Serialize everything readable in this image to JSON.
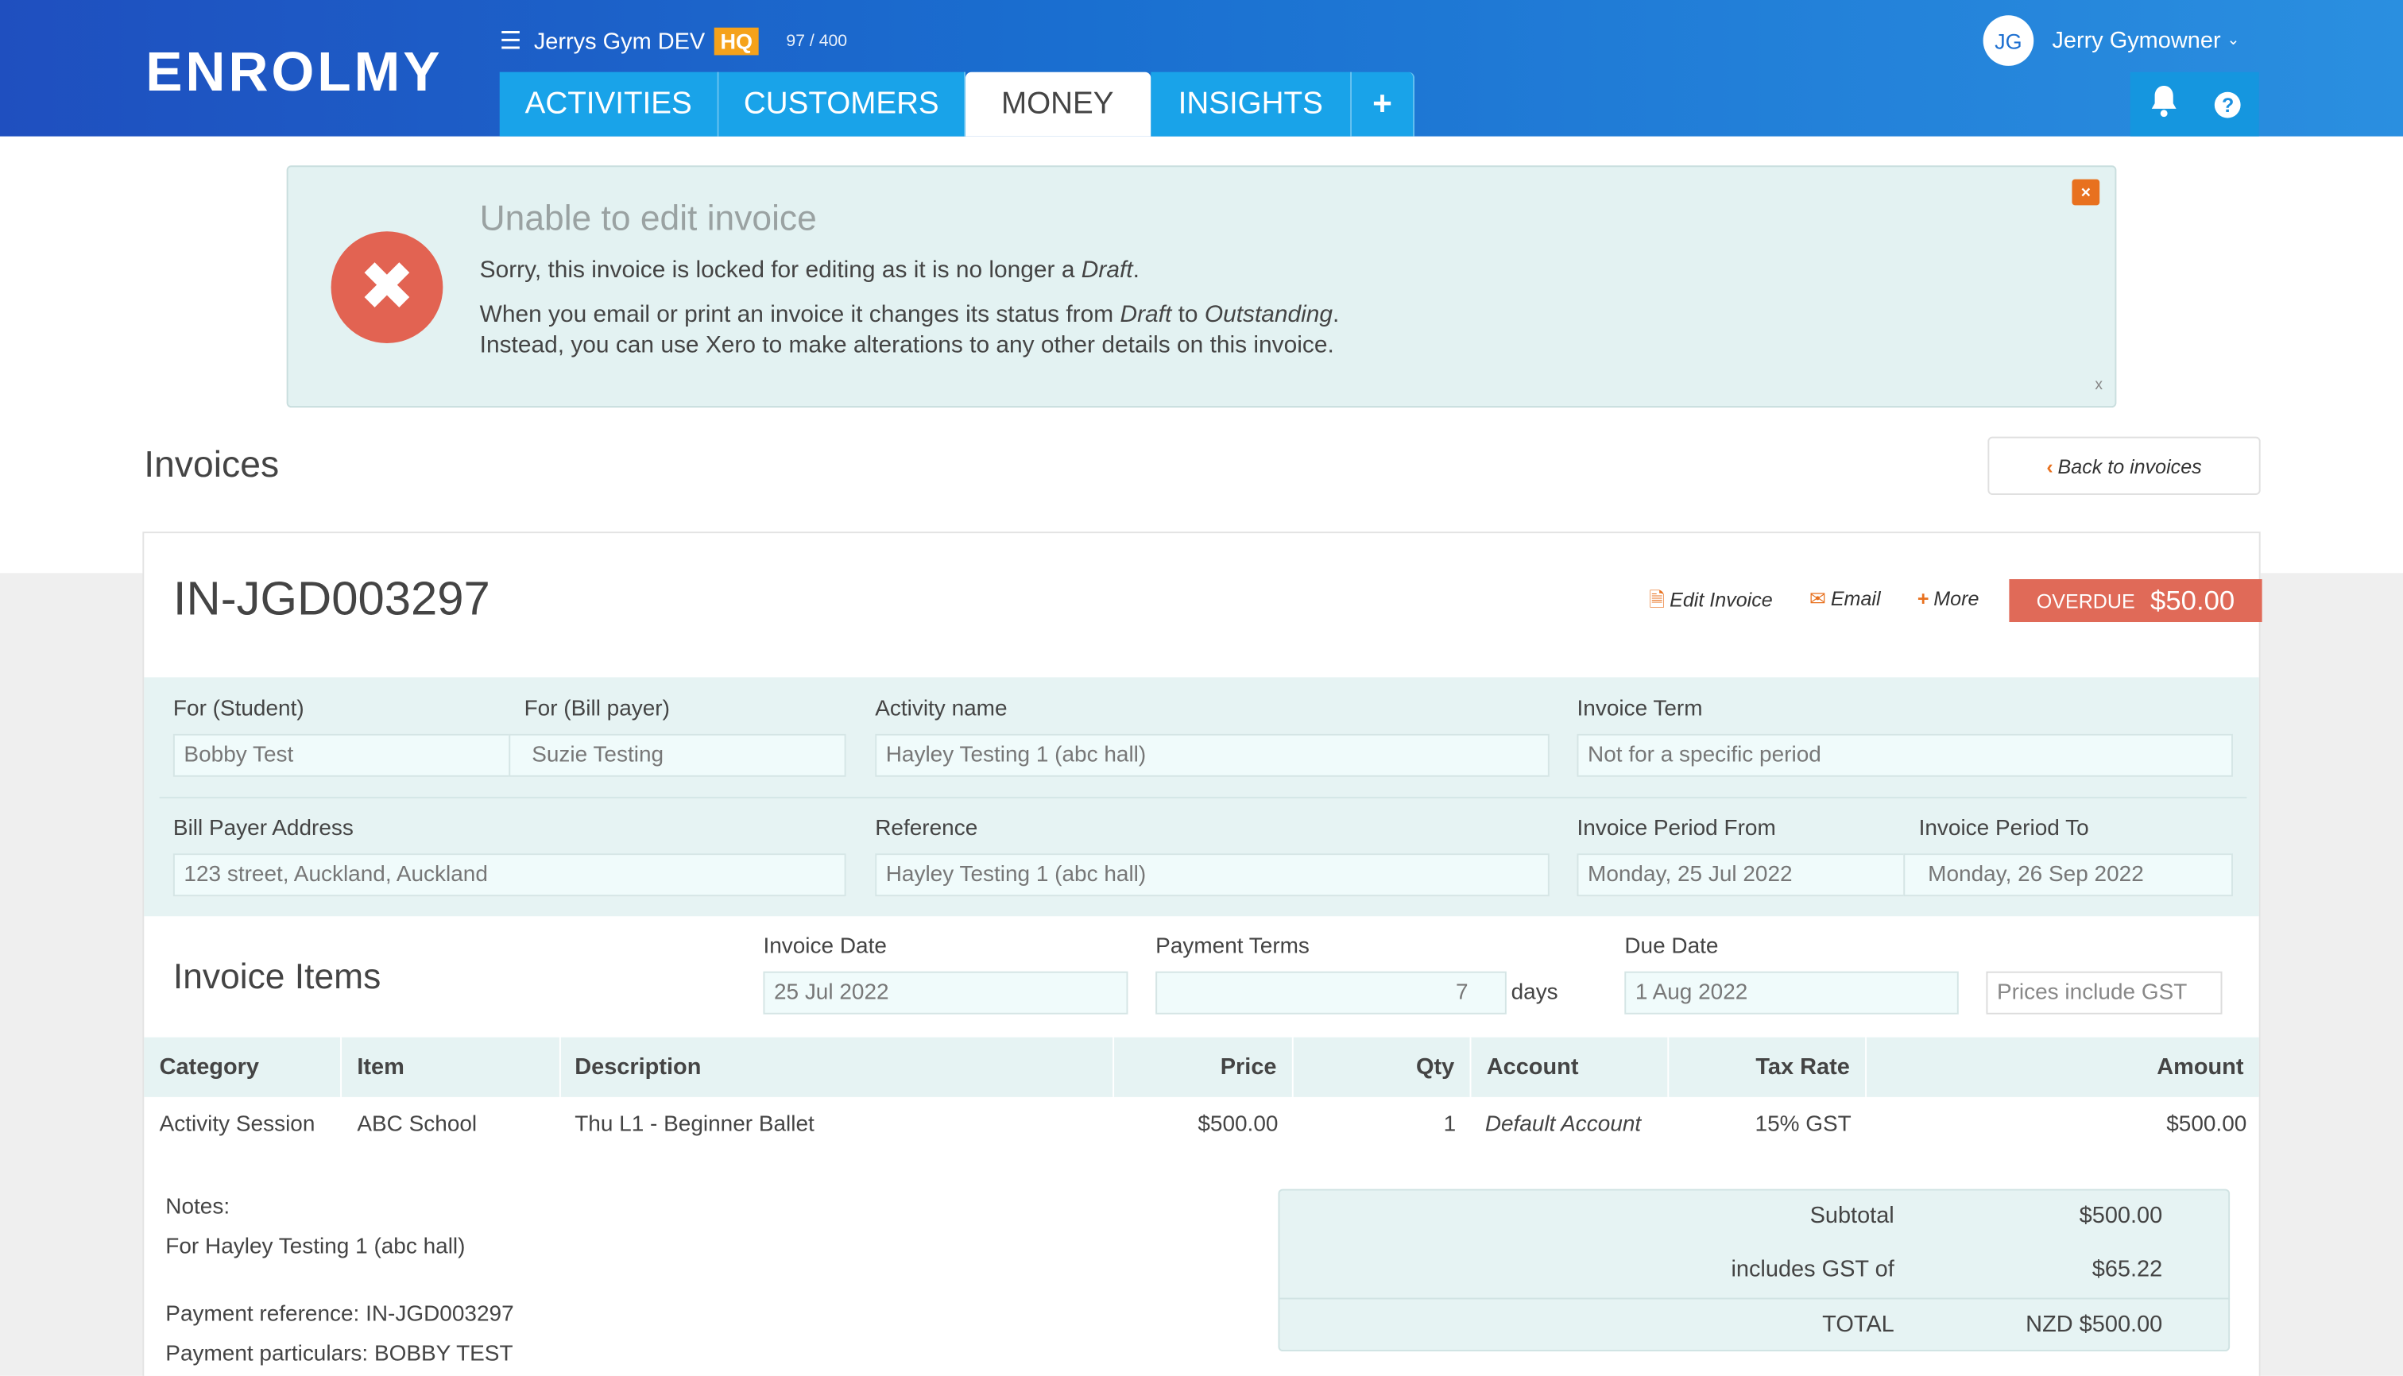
{
  "header": {
    "logo": "ENROLMY",
    "org_name": "Jerrys Gym DEV",
    "org_badge": "HQ",
    "usage": "97 / 400",
    "user_initials": "JG",
    "user_name": "Jerry Gymowner",
    "tabs": [
      {
        "label": "ACTIVITIES",
        "active": false
      },
      {
        "label": "CUSTOMERS",
        "active": false
      },
      {
        "label": "MONEY",
        "active": true
      },
      {
        "label": "INSIGHTS",
        "active": false
      }
    ],
    "add_tab": "+",
    "icons": [
      "menu-icon",
      "chevron-down-icon",
      "bell-icon",
      "help-icon"
    ]
  },
  "alert": {
    "title": "Unable to edit invoice",
    "line1_pre": "Sorry, this invoice is locked for editing as it is no longer a ",
    "line1_em": "Draft",
    "line1_post": ".",
    "line2_pre": "When you email or print an invoice it changes its status from ",
    "line2_em1": "Draft",
    "line2_mid": " to ",
    "line2_em2": "Outstanding",
    "line2_post": ".",
    "line3": "Instead, you can use Xero to make alterations to any other details on this invoice.",
    "close": "×",
    "small_close": "x",
    "color": "#e26352"
  },
  "page": {
    "title": "Invoices",
    "back": "Back to invoices"
  },
  "invoice": {
    "number": "IN-JGD003297",
    "actions": {
      "edit": "Edit Invoice",
      "email": "Email",
      "more": "More"
    },
    "status": "OVERDUE",
    "status_amount": "$50.00",
    "status_color": "#e06a58",
    "fields": {
      "student_label": "For (Student)",
      "student": "Bobby Test",
      "billpayer_label": "For (Bill payer)",
      "billpayer": "Suzie Testing",
      "activity_label": "Activity name",
      "activity": "Hayley Testing 1 (abc hall)",
      "term_label": "Invoice Term",
      "term": "Not for a specific period",
      "address_label": "Bill Payer Address",
      "address": "123 street, Auckland, Auckland",
      "reference_label": "Reference",
      "reference": "Hayley Testing 1 (abc hall)",
      "from_label": "Invoice Period From",
      "from": "Monday, 25 Jul 2022",
      "to_label": "Invoice Period To",
      "to": "Monday, 26 Sep 2022"
    },
    "items_title": "Invoice Items",
    "invoice_date_label": "Invoice Date",
    "invoice_date": "25 Jul 2022",
    "payment_terms_label": "Payment Terms",
    "payment_terms": "7",
    "days": "days",
    "due_date_label": "Due Date",
    "due_date": "1 Aug 2022",
    "gst_option": "Prices include GST",
    "columns": [
      "Category",
      "Item",
      "Description",
      "Price",
      "Qty",
      "Account",
      "Tax Rate",
      "Amount"
    ],
    "rows": [
      {
        "category": "Activity Session",
        "item": "ABC School",
        "description": "Thu L1 - Beginner Ballet",
        "price": "$500.00",
        "qty": "1",
        "account": "Default Account",
        "tax": "15% GST",
        "amount": "$500.00"
      }
    ],
    "notes_label": "Notes:",
    "notes_text": "For Hayley Testing 1 (abc hall)",
    "payment_ref": "Payment reference: IN-JGD003297",
    "payment_particulars": "Payment particulars: BOBBY TEST",
    "totals": {
      "subtotal_label": "Subtotal",
      "subtotal": "$500.00",
      "gst_label": "includes GST of",
      "gst": "$65.22",
      "total_label": "TOTAL",
      "total": "NZD $500.00"
    }
  }
}
